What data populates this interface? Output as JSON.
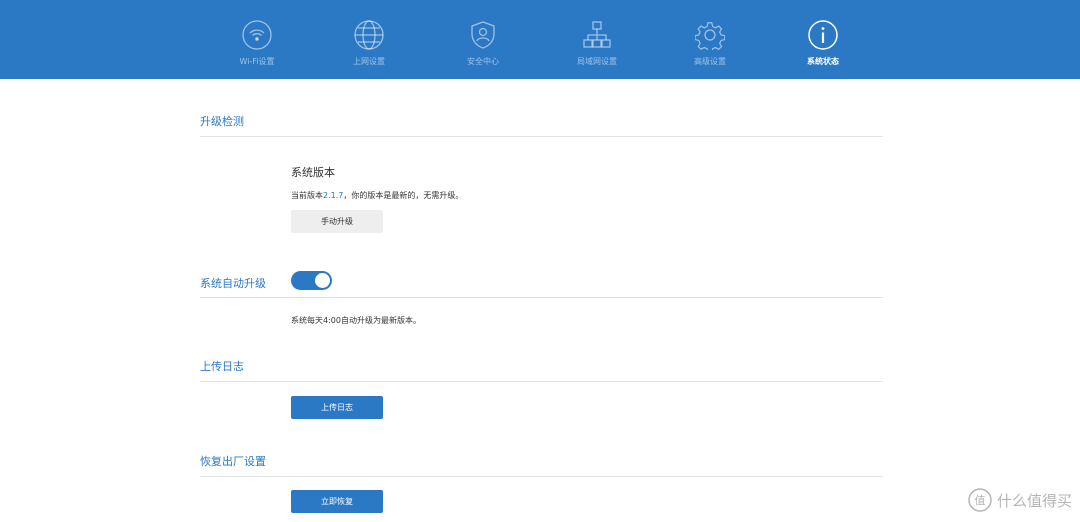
{
  "nav": {
    "items": [
      {
        "label": "Wi-Fi设置",
        "icon": "wifi-icon"
      },
      {
        "label": "上网设置",
        "icon": "globe-icon"
      },
      {
        "label": "安全中心",
        "icon": "shield-user-icon"
      },
      {
        "label": "局域网设置",
        "icon": "lan-network-icon"
      },
      {
        "label": "高级设置",
        "icon": "gear-icon"
      },
      {
        "label": "系统状态",
        "icon": "info-icon"
      }
    ],
    "active": "系统状态",
    "colors": {
      "bar": "#2b78c5",
      "accent": "#2b78c5"
    }
  },
  "upgrade": {
    "title": "升级检测",
    "system_version_label": "系统版本",
    "current_prefix": "当前版本",
    "version": "2.1.7",
    "current_suffix": "，你的版本是最新的，无需升级。",
    "manual_button": "手动升级"
  },
  "auto_upgrade": {
    "title": "系统自动升级",
    "enabled": true,
    "desc": "系统每天4:00自动升级为最新版本。"
  },
  "log": {
    "title": "上传日志",
    "button": "上传日志"
  },
  "reset": {
    "title": "恢复出厂设置",
    "button": "立即恢复"
  },
  "watermark": {
    "logo": "值",
    "text": "什么值得买"
  }
}
